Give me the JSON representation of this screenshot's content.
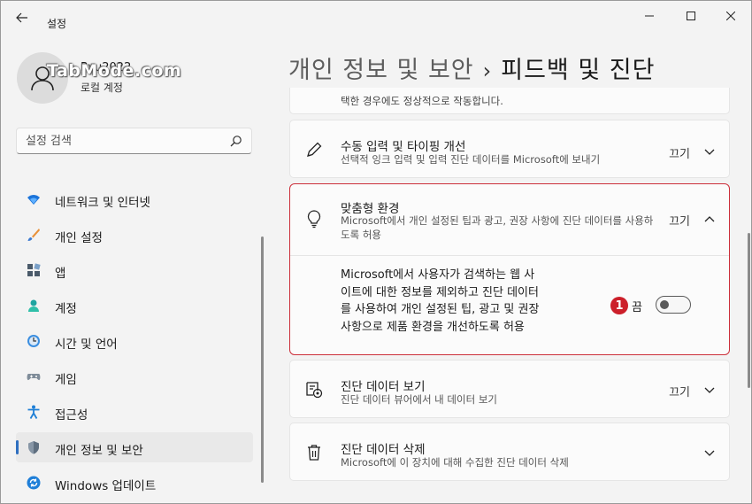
{
  "window": {
    "app_title": "설정"
  },
  "watermark": "TabMode.com",
  "user": {
    "name": "Ryu2022",
    "type": "로컬 계정"
  },
  "search": {
    "placeholder": "설정 검색"
  },
  "nav": [
    {
      "label": "네트워크 및 인터넷",
      "icon": "wifi-icon"
    },
    {
      "label": "개인 설정",
      "icon": "brush-icon"
    },
    {
      "label": "앱",
      "icon": "apps-icon"
    },
    {
      "label": "계정",
      "icon": "person-icon"
    },
    {
      "label": "시간 및 언어",
      "icon": "clock-globe-icon"
    },
    {
      "label": "게임",
      "icon": "gamepad-icon"
    },
    {
      "label": "접근성",
      "icon": "accessibility-icon"
    },
    {
      "label": "개인 정보 및 보안",
      "icon": "shield-icon",
      "active": true
    },
    {
      "label": "Windows 업데이트",
      "icon": "update-icon"
    }
  ],
  "breadcrumb": {
    "parent": "개인 정보 및 보안",
    "separator": "›",
    "current": "피드백 및 진단"
  },
  "settings": {
    "top_partial_desc": "택한 경우에도 정상적으로 작동합니다.",
    "handwriting": {
      "title": "수동 입력 및 타이핑 개선",
      "desc": "선택적 잉크 입력 및 입력 진단 데이터를 Microsoft에 보내기",
      "state": "끄기"
    },
    "tailored": {
      "title": "맞춤형 환경",
      "desc": "Microsoft에서 개인 설정된 팁과 광고, 권장 사항에 진단 데이터를 사용하도록 허용",
      "state": "끄기",
      "sub_text": "Microsoft에서 사용자가 검색하는 웹 사이트에 대한 정보를 제외하고 진단 데이터를 사용하여 개인 설정된 팁, 광고 및 권장 사항으로 제품 환경을 개선하도록 허용",
      "badge": "1",
      "toggle_label": "끔",
      "toggle_on": false
    },
    "view_data": {
      "title": "진단 데이터 보기",
      "desc": "진단 데이터 뷰어에서 내 데이터 보기",
      "state": "끄기"
    },
    "delete_data": {
      "title": "진단 데이터 삭제",
      "desc": "Microsoft에 이 장치에 대해 수집한 진단 데이터 삭제"
    }
  },
  "colors": {
    "accent": "#2f6fc0",
    "highlight_border": "#cc2f3a",
    "badge": "#cc1f2a"
  }
}
